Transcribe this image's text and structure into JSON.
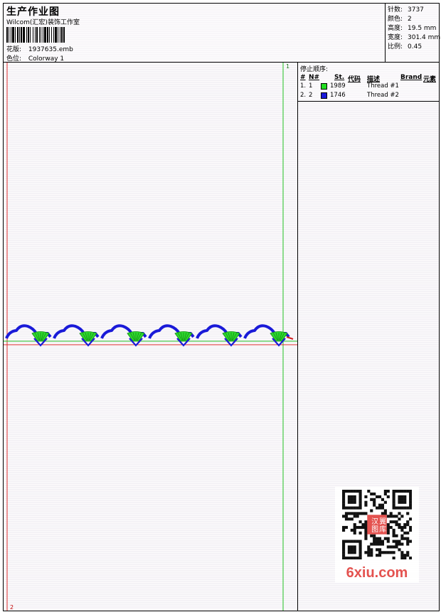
{
  "header": {
    "title": "生产作业图",
    "company": "Wilcom(汇宏)装饰工作室",
    "design_label": "花版:",
    "design_value": "1937635.emb",
    "colorway_label": "色位:",
    "colorway_value": "Colorway 1"
  },
  "stats": [
    {
      "label": "针数:",
      "value": "3737"
    },
    {
      "label": "颜色:",
      "value": "2"
    },
    {
      "label": "高度:",
      "value": "19.5 mm"
    },
    {
      "label": "宽度:",
      "value": "301.4 mm"
    },
    {
      "label": "比例:",
      "value": "0.45"
    }
  ],
  "canvas": {
    "marker_top": "1",
    "marker_bottom": "2",
    "motif_count": 6,
    "thread_colors": {
      "outline": "#1a1ad8",
      "fill": "#2ed82e",
      "guide_green": "#22c022",
      "guide_red": "#e03030"
    }
  },
  "stop_sequence": {
    "title": "停止顺序:",
    "headers": {
      "num": "#",
      "n": "N#",
      "st": "St.",
      "code": "代码",
      "desc": "描述",
      "brand": "Brand",
      "elem": "元素"
    },
    "rows": [
      {
        "num": "1.",
        "n": "1",
        "color": "#22dd22",
        "st": "1989",
        "desc": "Thread #1"
      },
      {
        "num": "2.",
        "n": "2",
        "color": "#1a1ad8",
        "st": "1746",
        "desc": "Thread #2"
      }
    ]
  },
  "watermark": {
    "qr_center_text": "汉翼图库",
    "site": "6xiu.com"
  }
}
